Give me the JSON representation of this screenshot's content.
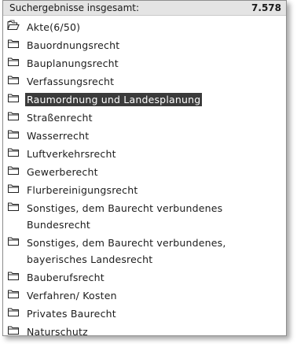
{
  "header": {
    "label": "Suchergebnisse insgesamt:",
    "count": "7.578"
  },
  "items": [
    {
      "label": "Akte(6/50)",
      "icon": "open-folder-icon"
    },
    {
      "label": "Bauordnungsrecht",
      "icon": "folder-icon"
    },
    {
      "label": "Bauplanungsrecht",
      "icon": "folder-icon"
    },
    {
      "label": "Verfassungsrecht",
      "icon": "folder-icon"
    },
    {
      "label": "Raumordnung und Landesplanung",
      "icon": "folder-icon",
      "selected": true
    },
    {
      "label": "Straßenrecht",
      "icon": "folder-icon"
    },
    {
      "label": "Wasserrecht",
      "icon": "folder-icon"
    },
    {
      "label": "Luftverkehrsrecht",
      "icon": "folder-icon"
    },
    {
      "label": "Gewerberecht",
      "icon": "folder-icon"
    },
    {
      "label": "Flurbereinigungsrecht",
      "icon": "folder-icon"
    },
    {
      "label": "Sonstiges, dem Baurecht verbundenes Bundesrecht",
      "icon": "folder-icon"
    },
    {
      "label": "Sonstiges, dem Baurecht verbundenes, bayerisches Landesrecht",
      "icon": "folder-icon"
    },
    {
      "label": "Bauberufsrecht",
      "icon": "folder-icon"
    },
    {
      "label": "Verfahren/ Kosten",
      "icon": "folder-icon"
    },
    {
      "label": "Privates Baurecht",
      "icon": "folder-icon"
    },
    {
      "label": "Naturschutz",
      "icon": "folder-icon"
    }
  ],
  "colors": {
    "header_bg": "#e4e4e4",
    "selection_bg": "#3b3b3b",
    "selection_text": "#ffffff"
  }
}
